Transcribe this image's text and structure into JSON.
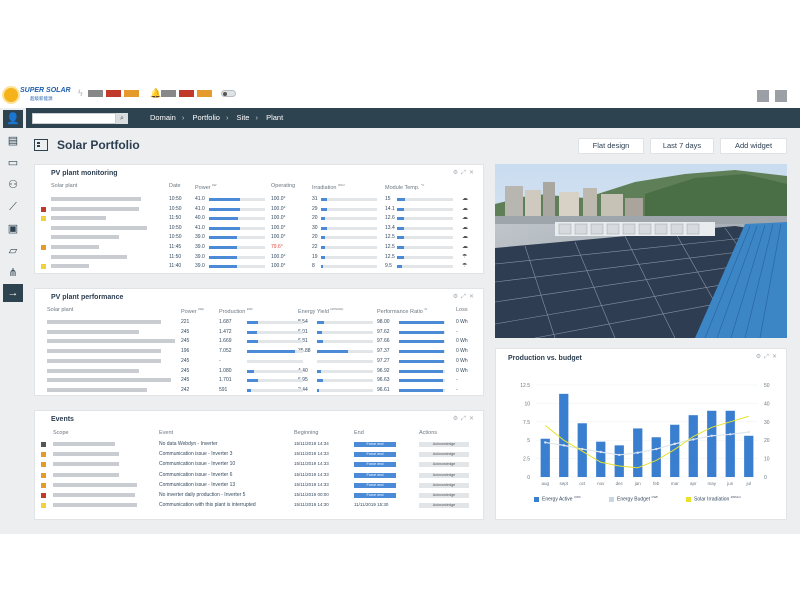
{
  "brand": {
    "name": "SUPER SOLAR",
    "subtitle": "超级新能源"
  },
  "header": {
    "search_placeholder": "",
    "search_icon": "search-icon",
    "alert_colors_1": [
      "#888888",
      "#c0392b",
      "#e59b2b"
    ],
    "alert_colors_2": [
      "#888888",
      "#c0392b",
      "#e59b2b"
    ]
  },
  "breadcrumb": [
    "Domain",
    "Portfolio",
    "Site",
    "Plant"
  ],
  "page": {
    "title": "Solar Portfolio"
  },
  "toolbar": {
    "flat_design": "Flat design",
    "period": "Last 7 days",
    "add_widget": "Add widget"
  },
  "monitoring": {
    "title": "PV plant monitoring",
    "headers": {
      "plant": "Solar plant",
      "date": "Date",
      "power": "Power",
      "power_unit": "kW",
      "operating": "Operating",
      "irradiation": "Irradiation",
      "irradiation_unit": "W/m²",
      "temp": "Module Temp.",
      "temp_unit": "°C"
    },
    "rows": [
      {
        "status": "",
        "date": "10:50",
        "power": "41.0",
        "power_pct": 0.55,
        "operating": "100.0°",
        "op_alert": false,
        "irr": "31",
        "irr_pct": 0.1,
        "temp": "15",
        "temp_pct": 0.15,
        "icon": "cloud-icon"
      },
      {
        "status": "#c0392b",
        "date": "10:50",
        "power": "41.0",
        "power_pct": 0.55,
        "operating": "100.0°",
        "op_alert": false,
        "irr": "29",
        "irr_pct": 0.1,
        "temp": "14.1",
        "temp_pct": 0.13,
        "icon": "cloud-icon"
      },
      {
        "status": "#f1d23a",
        "date": "11:50",
        "power": "40.0",
        "power_pct": 0.52,
        "operating": "100.0°",
        "op_alert": false,
        "irr": "20",
        "irr_pct": 0.07,
        "temp": "12.6",
        "temp_pct": 0.12,
        "icon": "cloud-icon"
      },
      {
        "status": "",
        "date": "10:50",
        "power": "41.0",
        "power_pct": 0.55,
        "operating": "100.0°",
        "op_alert": false,
        "irr": "30",
        "irr_pct": 0.1,
        "temp": "13.4",
        "temp_pct": 0.13,
        "icon": "cloud-icon"
      },
      {
        "status": "",
        "date": "10:50",
        "power": "39.0",
        "power_pct": 0.5,
        "operating": "100.0°",
        "op_alert": false,
        "irr": "20",
        "irr_pct": 0.07,
        "temp": "12.5",
        "temp_pct": 0.12,
        "icon": "cloud-icon"
      },
      {
        "status": "#e59b2b",
        "date": "11:45",
        "power": "39.0",
        "power_pct": 0.5,
        "operating": "79.6°",
        "op_alert": true,
        "irr": "22",
        "irr_pct": 0.08,
        "temp": "12.5",
        "temp_pct": 0.12,
        "icon": "cloud-icon"
      },
      {
        "status": "",
        "date": "11:50",
        "power": "39.0",
        "power_pct": 0.5,
        "operating": "100.0°",
        "op_alert": false,
        "irr": "19",
        "irr_pct": 0.07,
        "temp": "12.5",
        "temp_pct": 0.12,
        "icon": "rain-icon"
      },
      {
        "status": "#f1d23a",
        "date": "11:40",
        "power": "39.0",
        "power_pct": 0.5,
        "operating": "100.0°",
        "op_alert": false,
        "irr": "8",
        "irr_pct": 0.03,
        "temp": "9.5",
        "temp_pct": 0.09,
        "icon": "rain-icon"
      }
    ]
  },
  "performance": {
    "title": "PV plant performance",
    "headers": {
      "plant": "Solar plant",
      "power": "Power",
      "power_unit": "kWp",
      "production": "Production",
      "production_unit": "kWh",
      "yield": "Energy Yield",
      "yield_unit": "kWh/kWp",
      "ratio": "Performance Ratio",
      "ratio_unit": "%",
      "loss": "Loss"
    },
    "rows": [
      {
        "power": "221",
        "prod": "1.687",
        "prod_pct": 0.2,
        "yield": "8.54",
        "yield_pct": 0.12,
        "ratio": "98.00",
        "ratio_pct": 0.98,
        "loss": "0 Wh"
      },
      {
        "power": "245",
        "prod": "1.472",
        "prod_pct": 0.18,
        "yield": "6.01",
        "yield_pct": 0.09,
        "ratio": "97.62",
        "ratio_pct": 0.97,
        "loss": "-"
      },
      {
        "power": "245",
        "prod": "1.669",
        "prod_pct": 0.2,
        "yield": "6.81",
        "yield_pct": 0.1,
        "ratio": "97.66",
        "ratio_pct": 0.97,
        "loss": "0 Wh"
      },
      {
        "power": "196",
        "prod": "7.052",
        "prod_pct": 0.85,
        "yield": "35.88",
        "yield_pct": 0.55,
        "ratio": "97.37",
        "ratio_pct": 0.97,
        "loss": "0 Wh"
      },
      {
        "power": "245",
        "prod": "-",
        "prod_pct": 0,
        "yield": "-",
        "yield_pct": 0,
        "ratio": "97.27",
        "ratio_pct": 0.97,
        "loss": "0 Wh"
      },
      {
        "power": "245",
        "prod": "1.080",
        "prod_pct": 0.13,
        "yield": "4.40",
        "yield_pct": 0.07,
        "ratio": "96.92",
        "ratio_pct": 0.96,
        "loss": "0 Wh"
      },
      {
        "power": "245",
        "prod": "1.701",
        "prod_pct": 0.2,
        "yield": "6.95",
        "yield_pct": 0.1,
        "ratio": "96.63",
        "ratio_pct": 0.96,
        "loss": "-"
      },
      {
        "power": "242",
        "prod": "591",
        "prod_pct": 0.07,
        "yield": "2.44",
        "yield_pct": 0.04,
        "ratio": "96.61",
        "ratio_pct": 0.96,
        "loss": "-"
      }
    ]
  },
  "events": {
    "title": "Events",
    "headers": {
      "scope": "Scope",
      "event": "Event",
      "beginning": "Beginning",
      "end": "End",
      "actions": "Actions"
    },
    "force_label": "Force end",
    "ack_label": "Acknowledge",
    "rows": [
      {
        "status": "#555555",
        "event": "No data Webdyn - Inverter",
        "begin": "15/11/2019 14:34",
        "end": ""
      },
      {
        "status": "#e59b2b",
        "event": "Communication issue - Inverter 3",
        "begin": "15/11/2019 14:33",
        "end": ""
      },
      {
        "status": "#e59b2b",
        "event": "Communication issue - Inverter 10",
        "begin": "15/11/2019 14:33",
        "end": ""
      },
      {
        "status": "#e59b2b",
        "event": "Communication issue - Inverter 6",
        "begin": "15/11/2019 14:33",
        "end": ""
      },
      {
        "status": "#e59b2b",
        "event": "Communication issue - Inverter 13",
        "begin": "15/11/2019 14:33",
        "end": ""
      },
      {
        "status": "#c0392b",
        "event": "No inverter daily production - Inverter 5",
        "begin": "15/11/2019 00:00",
        "end": ""
      },
      {
        "status": "#f1d23a",
        "event": "Communication with this plant is interrupted",
        "begin": "15/11/2019 14:30",
        "end": "11/11/2019 15:30"
      }
    ]
  },
  "production": {
    "title": "Production vs. budget",
    "legend": {
      "active": "Energy Active",
      "active_unit": "CWh",
      "budget": "Energy Budget",
      "budget_unit": "CWh",
      "irr": "Solar Irradiation",
      "irr_unit": "kWh/m²"
    }
  },
  "chart_data": {
    "type": "bar",
    "title": "Production vs. budget",
    "categories": [
      "aug",
      "sept",
      "oct",
      "nov",
      "dec",
      "jan",
      "feb",
      "mar",
      "apr",
      "may",
      "jun",
      "jul"
    ],
    "series": [
      {
        "name": "Energy Active",
        "type": "bar",
        "color": "#3a7fcf",
        "values": [
          5.2,
          11.3,
          7.3,
          4.8,
          4.3,
          6.6,
          5.4,
          7.1,
          8.4,
          9.0,
          9.0,
          5.6
        ]
      },
      {
        "name": "Energy Budget",
        "type": "line",
        "color": "#c9d6e3",
        "values": [
          4.7,
          4.3,
          3.8,
          3.4,
          3.0,
          3.3,
          3.8,
          4.5,
          5.1,
          5.6,
          5.8,
          6.1
        ]
      },
      {
        "name": "Solar Irradiation",
        "type": "line",
        "color": "#e8e22a",
        "values": [
          28,
          20,
          14,
          8,
          6,
          5,
          9,
          15,
          22,
          27,
          30,
          33
        ]
      }
    ],
    "ylim": [
      0,
      12.5
    ],
    "y_ticks": [
      "0",
      "2.5",
      "5",
      "7.5",
      "10",
      "12.5"
    ],
    "y2lim": [
      0,
      50
    ],
    "y2_ticks": [
      "0",
      "10",
      "20",
      "30",
      "40",
      "50"
    ],
    "legend_position": "bottom"
  }
}
